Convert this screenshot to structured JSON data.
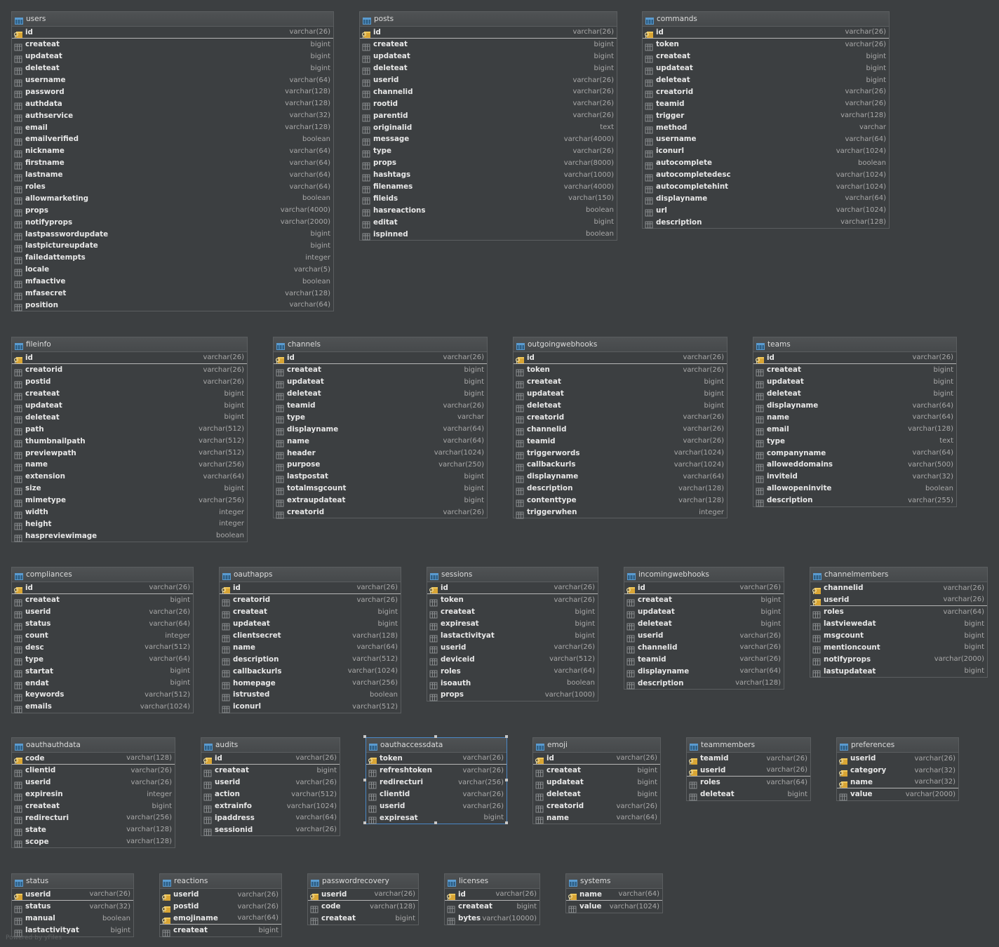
{
  "footer": "Powered by yFiles",
  "colors": {
    "background": "#3c3f41",
    "key_icon": "#d9a534",
    "col_icon": "#8a8d8f",
    "selection": "#4a88c7"
  },
  "tables": [
    {
      "name": "users",
      "key": [
        [
          "id",
          "varchar(26)"
        ]
      ],
      "cols": [
        [
          "createat",
          "bigint"
        ],
        [
          "updateat",
          "bigint"
        ],
        [
          "deleteat",
          "bigint"
        ],
        [
          "username",
          "varchar(64)"
        ],
        [
          "password",
          "varchar(128)"
        ],
        [
          "authdata",
          "varchar(128)"
        ],
        [
          "authservice",
          "varchar(32)"
        ],
        [
          "email",
          "varchar(128)"
        ],
        [
          "emailverified",
          "boolean"
        ],
        [
          "nickname",
          "varchar(64)"
        ],
        [
          "firstname",
          "varchar(64)"
        ],
        [
          "lastname",
          "varchar(64)"
        ],
        [
          "roles",
          "varchar(64)"
        ],
        [
          "allowmarketing",
          "boolean"
        ],
        [
          "props",
          "varchar(4000)"
        ],
        [
          "notifyprops",
          "varchar(2000)"
        ],
        [
          "lastpasswordupdate",
          "bigint"
        ],
        [
          "lastpictureupdate",
          "bigint"
        ],
        [
          "failedattempts",
          "integer"
        ],
        [
          "locale",
          "varchar(5)"
        ],
        [
          "mfaactive",
          "boolean"
        ],
        [
          "mfasecret",
          "varchar(128)"
        ],
        [
          "position",
          "varchar(64)"
        ]
      ]
    },
    {
      "name": "posts",
      "key": [
        [
          "id",
          "varchar(26)"
        ]
      ],
      "cols": [
        [
          "createat",
          "bigint"
        ],
        [
          "updateat",
          "bigint"
        ],
        [
          "deleteat",
          "bigint"
        ],
        [
          "userid",
          "varchar(26)"
        ],
        [
          "channelid",
          "varchar(26)"
        ],
        [
          "rootid",
          "varchar(26)"
        ],
        [
          "parentid",
          "varchar(26)"
        ],
        [
          "originalid",
          "text"
        ],
        [
          "message",
          "varchar(4000)"
        ],
        [
          "type",
          "varchar(26)"
        ],
        [
          "props",
          "varchar(8000)"
        ],
        [
          "hashtags",
          "varchar(1000)"
        ],
        [
          "filenames",
          "varchar(4000)"
        ],
        [
          "fileids",
          "varchar(150)"
        ],
        [
          "hasreactions",
          "boolean"
        ],
        [
          "editat",
          "bigint"
        ],
        [
          "ispinned",
          "boolean"
        ]
      ]
    },
    {
      "name": "commands",
      "key": [
        [
          "id",
          "varchar(26)"
        ]
      ],
      "cols": [
        [
          "token",
          "varchar(26)"
        ],
        [
          "createat",
          "bigint"
        ],
        [
          "updateat",
          "bigint"
        ],
        [
          "deleteat",
          "bigint"
        ],
        [
          "creatorid",
          "varchar(26)"
        ],
        [
          "teamid",
          "varchar(26)"
        ],
        [
          "trigger",
          "varchar(128)"
        ],
        [
          "method",
          "varchar"
        ],
        [
          "username",
          "varchar(64)"
        ],
        [
          "iconurl",
          "varchar(1024)"
        ],
        [
          "autocomplete",
          "boolean"
        ],
        [
          "autocompletedesc",
          "varchar(1024)"
        ],
        [
          "autocompletehint",
          "varchar(1024)"
        ],
        [
          "displayname",
          "varchar(64)"
        ],
        [
          "url",
          "varchar(1024)"
        ],
        [
          "description",
          "varchar(128)"
        ]
      ]
    },
    {
      "name": "fileinfo",
      "key": [
        [
          "id",
          "varchar(26)"
        ]
      ],
      "cols": [
        [
          "creatorid",
          "varchar(26)"
        ],
        [
          "postid",
          "varchar(26)"
        ],
        [
          "createat",
          "bigint"
        ],
        [
          "updateat",
          "bigint"
        ],
        [
          "deleteat",
          "bigint"
        ],
        [
          "path",
          "varchar(512)"
        ],
        [
          "thumbnailpath",
          "varchar(512)"
        ],
        [
          "previewpath",
          "varchar(512)"
        ],
        [
          "name",
          "varchar(256)"
        ],
        [
          "extension",
          "varchar(64)"
        ],
        [
          "size",
          "bigint"
        ],
        [
          "mimetype",
          "varchar(256)"
        ],
        [
          "width",
          "integer"
        ],
        [
          "height",
          "integer"
        ],
        [
          "haspreviewimage",
          "boolean"
        ]
      ]
    },
    {
      "name": "channels",
      "key": [
        [
          "id",
          "varchar(26)"
        ]
      ],
      "cols": [
        [
          "createat",
          "bigint"
        ],
        [
          "updateat",
          "bigint"
        ],
        [
          "deleteat",
          "bigint"
        ],
        [
          "teamid",
          "varchar(26)"
        ],
        [
          "type",
          "varchar"
        ],
        [
          "displayname",
          "varchar(64)"
        ],
        [
          "name",
          "varchar(64)"
        ],
        [
          "header",
          "varchar(1024)"
        ],
        [
          "purpose",
          "varchar(250)"
        ],
        [
          "lastpostat",
          "bigint"
        ],
        [
          "totalmsgcount",
          "bigint"
        ],
        [
          "extraupdateat",
          "bigint"
        ],
        [
          "creatorid",
          "varchar(26)"
        ]
      ]
    },
    {
      "name": "outgoingwebhooks",
      "key": [
        [
          "id",
          "varchar(26)"
        ]
      ],
      "cols": [
        [
          "token",
          "varchar(26)"
        ],
        [
          "createat",
          "bigint"
        ],
        [
          "updateat",
          "bigint"
        ],
        [
          "deleteat",
          "bigint"
        ],
        [
          "creatorid",
          "varchar(26)"
        ],
        [
          "channelid",
          "varchar(26)"
        ],
        [
          "teamid",
          "varchar(26)"
        ],
        [
          "triggerwords",
          "varchar(1024)"
        ],
        [
          "callbackurls",
          "varchar(1024)"
        ],
        [
          "displayname",
          "varchar(64)"
        ],
        [
          "description",
          "varchar(128)"
        ],
        [
          "contenttype",
          "varchar(128)"
        ],
        [
          "triggerwhen",
          "integer"
        ]
      ]
    },
    {
      "name": "teams",
      "key": [
        [
          "id",
          "varchar(26)"
        ]
      ],
      "cols": [
        [
          "createat",
          "bigint"
        ],
        [
          "updateat",
          "bigint"
        ],
        [
          "deleteat",
          "bigint"
        ],
        [
          "displayname",
          "varchar(64)"
        ],
        [
          "name",
          "varchar(64)"
        ],
        [
          "email",
          "varchar(128)"
        ],
        [
          "type",
          "text"
        ],
        [
          "companyname",
          "varchar(64)"
        ],
        [
          "alloweddomains",
          "varchar(500)"
        ],
        [
          "inviteid",
          "varchar(32)"
        ],
        [
          "allowopeninvite",
          "boolean"
        ],
        [
          "description",
          "varchar(255)"
        ]
      ]
    },
    {
      "name": "compliances",
      "key": [
        [
          "id",
          "varchar(26)"
        ]
      ],
      "cols": [
        [
          "createat",
          "bigint"
        ],
        [
          "userid",
          "varchar(26)"
        ],
        [
          "status",
          "varchar(64)"
        ],
        [
          "count",
          "integer"
        ],
        [
          "desc",
          "varchar(512)"
        ],
        [
          "type",
          "varchar(64)"
        ],
        [
          "startat",
          "bigint"
        ],
        [
          "endat",
          "bigint"
        ],
        [
          "keywords",
          "varchar(512)"
        ],
        [
          "emails",
          "varchar(1024)"
        ]
      ]
    },
    {
      "name": "oauthapps",
      "key": [
        [
          "id",
          "varchar(26)"
        ]
      ],
      "cols": [
        [
          "creatorid",
          "varchar(26)"
        ],
        [
          "createat",
          "bigint"
        ],
        [
          "updateat",
          "bigint"
        ],
        [
          "clientsecret",
          "varchar(128)"
        ],
        [
          "name",
          "varchar(64)"
        ],
        [
          "description",
          "varchar(512)"
        ],
        [
          "callbackurls",
          "varchar(1024)"
        ],
        [
          "homepage",
          "varchar(256)"
        ],
        [
          "istrusted",
          "boolean"
        ],
        [
          "iconurl",
          "varchar(512)"
        ]
      ]
    },
    {
      "name": "sessions",
      "key": [
        [
          "id",
          "varchar(26)"
        ]
      ],
      "cols": [
        [
          "token",
          "varchar(26)"
        ],
        [
          "createat",
          "bigint"
        ],
        [
          "expiresat",
          "bigint"
        ],
        [
          "lastactivityat",
          "bigint"
        ],
        [
          "userid",
          "varchar(26)"
        ],
        [
          "deviceid",
          "varchar(512)"
        ],
        [
          "roles",
          "varchar(64)"
        ],
        [
          "isoauth",
          "boolean"
        ],
        [
          "props",
          "varchar(1000)"
        ]
      ]
    },
    {
      "name": "incomingwebhooks",
      "key": [
        [
          "id",
          "varchar(26)"
        ]
      ],
      "cols": [
        [
          "createat",
          "bigint"
        ],
        [
          "updateat",
          "bigint"
        ],
        [
          "deleteat",
          "bigint"
        ],
        [
          "userid",
          "varchar(26)"
        ],
        [
          "channelid",
          "varchar(26)"
        ],
        [
          "teamid",
          "varchar(26)"
        ],
        [
          "displayname",
          "varchar(64)"
        ],
        [
          "description",
          "varchar(128)"
        ]
      ]
    },
    {
      "name": "channelmembers",
      "key": [
        [
          "channelid",
          "varchar(26)"
        ],
        [
          "userid",
          "varchar(26)"
        ]
      ],
      "cols": [
        [
          "roles",
          "varchar(64)"
        ],
        [
          "lastviewedat",
          "bigint"
        ],
        [
          "msgcount",
          "bigint"
        ],
        [
          "mentioncount",
          "bigint"
        ],
        [
          "notifyprops",
          "varchar(2000)"
        ],
        [
          "lastupdateat",
          "bigint"
        ]
      ]
    },
    {
      "name": "oauthauthdata",
      "key": [
        [
          "code",
          "varchar(128)"
        ]
      ],
      "cols": [
        [
          "clientid",
          "varchar(26)"
        ],
        [
          "userid",
          "varchar(26)"
        ],
        [
          "expiresin",
          "integer"
        ],
        [
          "createat",
          "bigint"
        ],
        [
          "redirecturi",
          "varchar(256)"
        ],
        [
          "state",
          "varchar(128)"
        ],
        [
          "scope",
          "varchar(128)"
        ]
      ]
    },
    {
      "name": "audits",
      "key": [
        [
          "id",
          "varchar(26)"
        ]
      ],
      "cols": [
        [
          "createat",
          "bigint"
        ],
        [
          "userid",
          "varchar(26)"
        ],
        [
          "action",
          "varchar(512)"
        ],
        [
          "extrainfo",
          "varchar(1024)"
        ],
        [
          "ipaddress",
          "varchar(64)"
        ],
        [
          "sessionid",
          "varchar(26)"
        ]
      ]
    },
    {
      "name": "oauthaccessdata",
      "key": [
        [
          "token",
          "varchar(26)"
        ]
      ],
      "cols": [
        [
          "refreshtoken",
          "varchar(26)"
        ],
        [
          "redirecturi",
          "varchar(256)"
        ],
        [
          "clientid",
          "varchar(26)"
        ],
        [
          "userid",
          "varchar(26)"
        ],
        [
          "expiresat",
          "bigint"
        ]
      ],
      "selected": true
    },
    {
      "name": "emoji",
      "key": [
        [
          "id",
          "varchar(26)"
        ]
      ],
      "cols": [
        [
          "createat",
          "bigint"
        ],
        [
          "updateat",
          "bigint"
        ],
        [
          "deleteat",
          "bigint"
        ],
        [
          "creatorid",
          "varchar(26)"
        ],
        [
          "name",
          "varchar(64)"
        ]
      ]
    },
    {
      "name": "teammembers",
      "key": [
        [
          "teamid",
          "varchar(26)"
        ],
        [
          "userid",
          "varchar(26)"
        ]
      ],
      "cols": [
        [
          "roles",
          "varchar(64)"
        ],
        [
          "deleteat",
          "bigint"
        ]
      ]
    },
    {
      "name": "preferences",
      "key": [
        [
          "userid",
          "varchar(26)"
        ],
        [
          "category",
          "varchar(32)"
        ],
        [
          "name",
          "varchar(32)"
        ]
      ],
      "cols": [
        [
          "value",
          "varchar(2000)"
        ]
      ]
    },
    {
      "name": "status",
      "key": [
        [
          "userid",
          "varchar(26)"
        ]
      ],
      "cols": [
        [
          "status",
          "varchar(32)"
        ],
        [
          "manual",
          "boolean"
        ],
        [
          "lastactivityat",
          "bigint"
        ]
      ]
    },
    {
      "name": "reactions",
      "key": [
        [
          "userid",
          "varchar(26)"
        ],
        [
          "postid",
          "varchar(26)"
        ],
        [
          "emojiname",
          "varchar(64)"
        ]
      ],
      "cols": [
        [
          "createat",
          "bigint"
        ]
      ]
    },
    {
      "name": "passwordrecovery",
      "key": [
        [
          "userid",
          "varchar(26)"
        ]
      ],
      "cols": [
        [
          "code",
          "varchar(128)"
        ],
        [
          "createat",
          "bigint"
        ]
      ]
    },
    {
      "name": "licenses",
      "key": [
        [
          "id",
          "varchar(26)"
        ]
      ],
      "cols": [
        [
          "createat",
          "bigint"
        ],
        [
          "bytes",
          "varchar(10000)"
        ]
      ]
    },
    {
      "name": "systems",
      "key": [
        [
          "name",
          "varchar(64)"
        ]
      ],
      "cols": [
        [
          "value",
          "varchar(1024)"
        ]
      ]
    }
  ]
}
